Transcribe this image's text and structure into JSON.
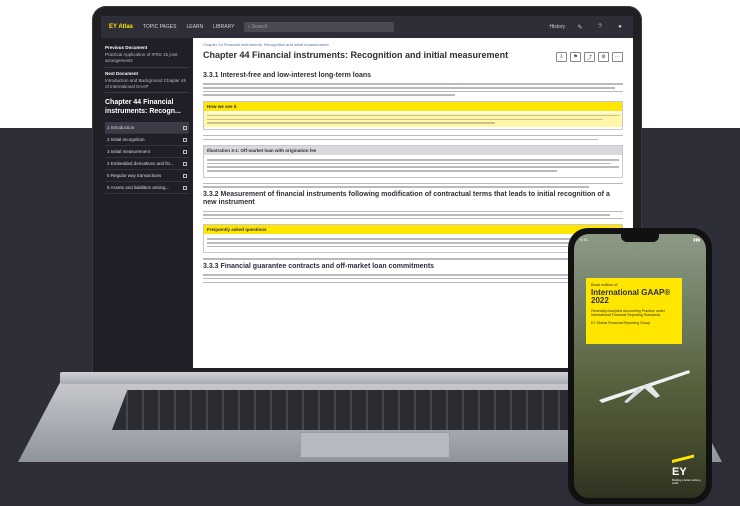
{
  "app": {
    "logo": "EY Atlas",
    "nav": [
      "TOPIC PAGES",
      "LEARN",
      "LIBRARY"
    ],
    "search_placeholder": "Search",
    "history": "History"
  },
  "sidebar": {
    "previous_label": "Previous Document",
    "previous_text": "Practical Application of IFRS 15 joint arrangements",
    "next_label": "Next Document",
    "next_text": "Introduction and Background Chapter 45 of International GAAP",
    "chapter_title": "Chapter 44 Financial instruments: Recogn...",
    "toc": [
      "1 Introduction",
      "2 Initial recognition",
      "3 Initial measurement",
      "4 Embedded derivatives and fin...",
      "5 Regular way transactions",
      "6 Assets and liabilities arising..."
    ]
  },
  "main": {
    "breadcrumb": "Chapter 44 Financial instruments: Recognition and initial measurement",
    "title": "Chapter 44 Financial instruments: Recognition and initial measurement",
    "h_331": "3.3.1 Interest-free and low-interest long-term loans",
    "callout1_head": "How we see it",
    "callout2_head": "Illustration 3-1: Off-market loan with origination fee",
    "h_332": "3.3.2 Measurement of financial instruments following modification of contractual terms that leads to initial recognition of a new instrument",
    "faq_head": "Frequently asked questions",
    "h_333": "3.3.3 Financial guarantee contracts and off-market loan commitments"
  },
  "phone": {
    "status_time": "9:41",
    "status_icons": "▮▮▮",
    "cover_kicker": "Book edition of",
    "cover_title": "International GAAP® 2022",
    "cover_subtitle": "Generally Accepted Accounting Practice under International Financial Reporting Standards",
    "cover_date": "EY Global Financial Reporting Group",
    "logo": "EY",
    "tagline": "Building a better working world"
  },
  "colors": {
    "brand_yellow": "#ffe600",
    "brand_dark": "#2e2e38"
  }
}
